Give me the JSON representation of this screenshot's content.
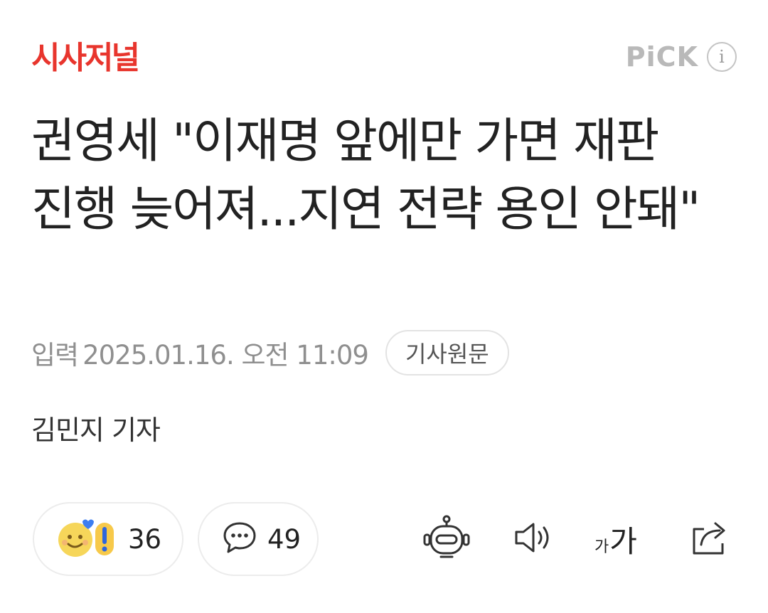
{
  "header": {
    "press_logo": "시사저널",
    "pick_label": "PiCK",
    "info_symbol": "i"
  },
  "article": {
    "headline": "권영세 \"이재명 앞에만 가면 재판 진행 늦어져...지연 전략 용인 안돼\"",
    "input_label": "입력",
    "datetime": "2025.01.16. 오전 11:09",
    "source_button": "기사원문",
    "byline": "김민지 기자"
  },
  "actions": {
    "reactions_count": "36",
    "comments_count": "49",
    "font_small": "가",
    "font_large": "가"
  },
  "icons": [
    "reaction-emoji-icon",
    "comment-icon",
    "summary-bot-icon",
    "speaker-icon",
    "font-size-icon",
    "share-icon",
    "info-icon"
  ],
  "colors": {
    "brand_red": "#e8352d",
    "pick_gray": "#b9b9b9",
    "meta_gray": "#8f8f8f"
  }
}
